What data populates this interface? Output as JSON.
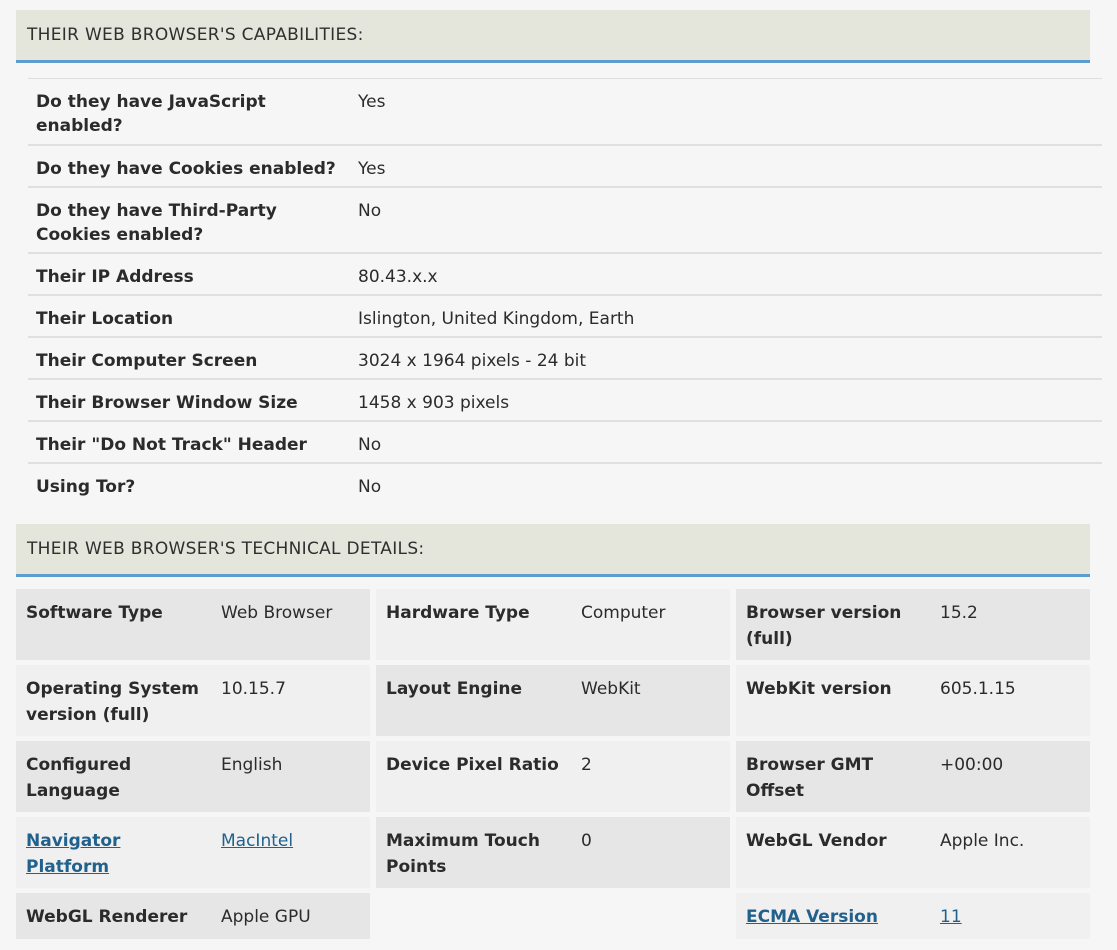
{
  "capabilities": {
    "header": "THEIR WEB BROWSER'S CAPABILITIES:",
    "rows": [
      {
        "label": "Do they have JavaScript enabled?",
        "value": "Yes"
      },
      {
        "label": "Do they have Cookies enabled?",
        "value": "Yes"
      },
      {
        "label": "Do they have Third-Party Cookies enabled?",
        "value": "No"
      },
      {
        "label": "Their IP Address",
        "value": "80.43.x.x"
      },
      {
        "label": "Their Location",
        "value": "Islington, United Kingdom, Earth"
      },
      {
        "label": "Their Computer Screen",
        "value": "3024 x 1964 pixels - 24 bit"
      },
      {
        "label": "Their Browser Window Size",
        "value": "1458 x 903 pixels"
      },
      {
        "label": "Their \"Do Not Track\" Header",
        "value": "No"
      },
      {
        "label": "Using Tor?",
        "value": "No"
      }
    ]
  },
  "technical": {
    "header": "THEIR WEB BROWSER'S TECHNICAL DETAILS:",
    "cells": [
      {
        "label": "Software Type",
        "value": "Web Browser"
      },
      {
        "label": "Hardware Type",
        "value": "Computer"
      },
      {
        "label": "Browser version (full)",
        "value": "15.2"
      },
      {
        "label": "Operating System version (full)",
        "value": "10.15.7"
      },
      {
        "label": "Layout Engine",
        "value": "WebKit"
      },
      {
        "label": "WebKit version",
        "value": "605.1.15"
      },
      {
        "label": "Configured Language",
        "value": "English"
      },
      {
        "label": "Device Pixel Ratio",
        "value": "2"
      },
      {
        "label": "Browser GMT Offset",
        "value": "+00:00"
      },
      {
        "label": "Navigator Platform",
        "value": "MacIntel"
      },
      {
        "label": "Maximum Touch Points",
        "value": "0"
      },
      {
        "label": "WebGL Vendor",
        "value": "Apple Inc."
      },
      {
        "label": "WebGL Renderer",
        "value": "Apple GPU"
      },
      {
        "label": "ECMA Version",
        "value": "11"
      }
    ]
  },
  "colors": {
    "header_bg": "#e4e6dc",
    "header_border": "#5d9ccc",
    "link": "#21618c"
  }
}
